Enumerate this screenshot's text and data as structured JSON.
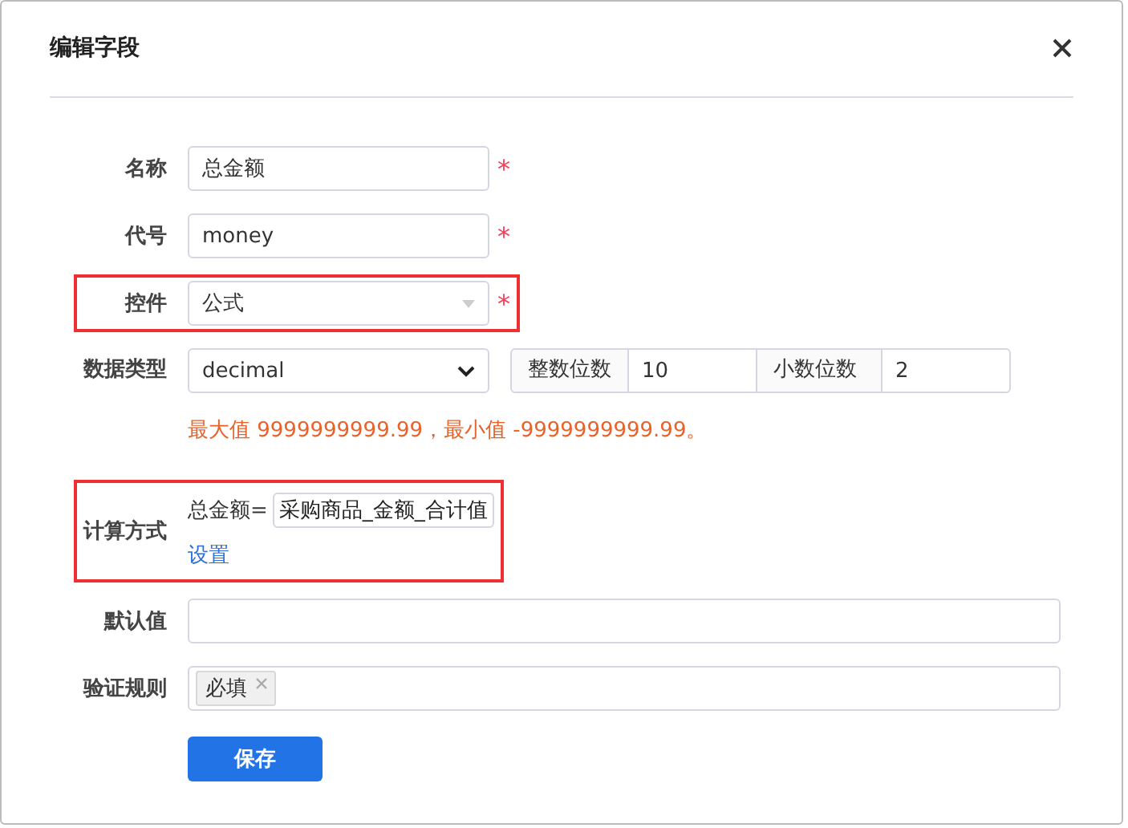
{
  "dialog": {
    "title": "编辑字段"
  },
  "fields": [
    {
      "kind": "text",
      "label": "名称",
      "value": "总金额",
      "required": true,
      "highlighted": false
    },
    {
      "kind": "text",
      "label": "代号",
      "value": "money",
      "required": true,
      "highlighted": false
    },
    {
      "kind": "combo",
      "label": "控件",
      "value": "公式",
      "required": true,
      "highlighted": true
    },
    {
      "kind": "select",
      "label": "数据类型",
      "value": "decimal",
      "integer_digits": {
        "label": "整数位数",
        "value": "10"
      },
      "decimal_digits": {
        "label": "小数位数",
        "value": "2"
      },
      "hint": "最大值 9999999999.99，最小值 -9999999999.99。",
      "required": false,
      "highlighted": false
    },
    {
      "kind": "formula",
      "label": "计算方式",
      "prefix": "总金额=",
      "value": "采购商品_金额_合计值",
      "link": "设置",
      "required": false,
      "highlighted": true
    },
    {
      "kind": "wide",
      "label": "默认值",
      "required": false,
      "highlighted": false
    },
    {
      "kind": "tags",
      "label": "验证规则",
      "tags": [
        "必填"
      ],
      "required": false,
      "highlighted": false
    }
  ],
  "required_mark": "*",
  "save_button": "保存"
}
